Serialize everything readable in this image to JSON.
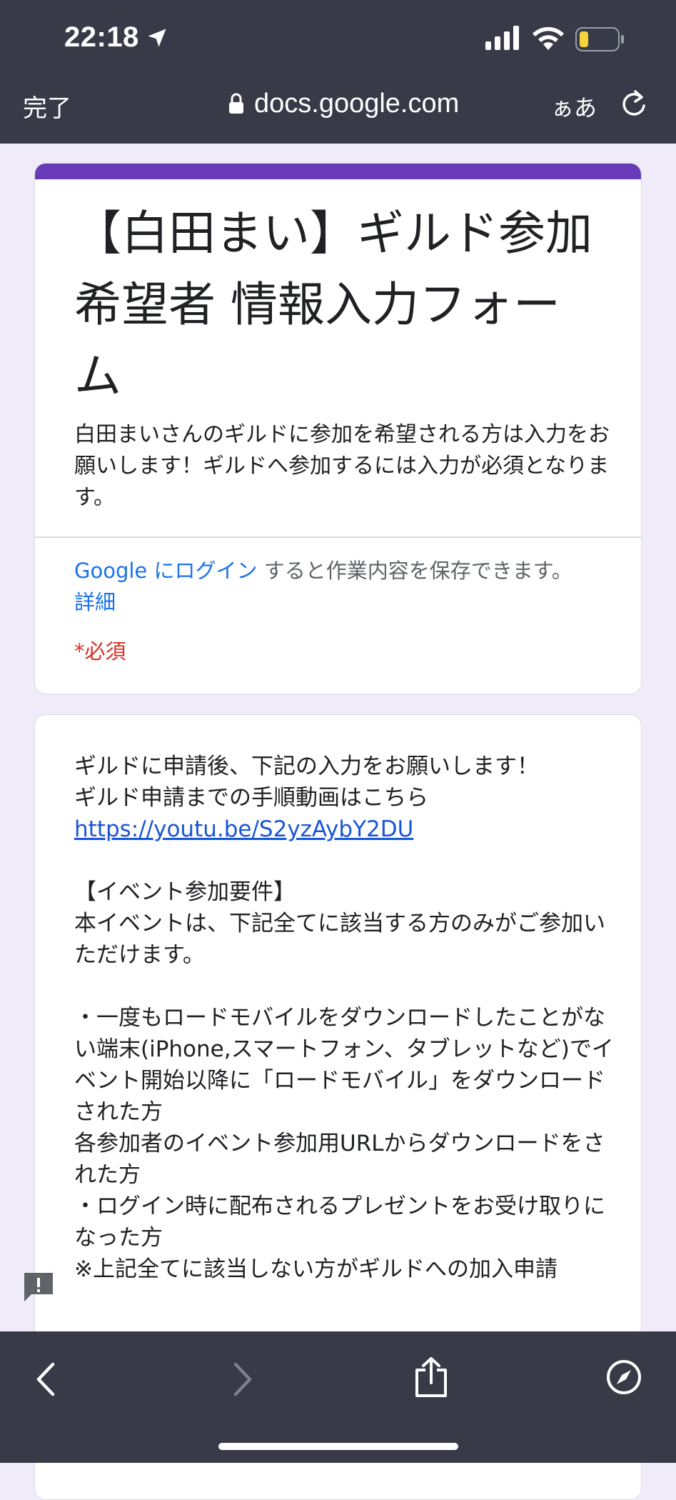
{
  "status_bar": {
    "time": "22:18",
    "icons": [
      "location-arrow-icon",
      "cellular-signal-icon",
      "wifi-icon",
      "battery-icon"
    ],
    "battery_color": "#f5d33a"
  },
  "browser": {
    "done_label": "完了",
    "url": "docs.google.com",
    "text_size_label": "ぁあ",
    "icons": [
      "lock-icon",
      "reload-icon"
    ]
  },
  "form": {
    "accent_color": "#673ab7",
    "title": "【白田まい】ギルド参加希望者 情報入力フォーム",
    "description": "白田まいさんのギルドに参加を希望される方は入力をお願いします！ギルドへ参加するには入力が必須となります。",
    "login_link": "Google にログイン",
    "login_rest": "すると作業内容を保存できます。",
    "details_link": "詳細",
    "required_label": "*必須"
  },
  "section": {
    "line1": "ギルドに申請後、下記の入力をお願いします！",
    "line2": "ギルド申請までの手順動画はこちら",
    "video_url": "https://youtu.be/S2yzAybY2DU",
    "requirements_heading": "【イベント参加要件】",
    "requirements_intro": "本イベントは、下記全てに該当する方のみがご参加いただけます。",
    "req1": "・一度もロードモバイルをダウンロードしたことがない端末(iPhone,スマートフォン、タブレットなど)でイベント開始以降に「ロードモバイル」をダウンロードされた方",
    "req2": "各参加者のイベント参加用URLからダウンロードをされた方",
    "req3": "・ログイン時に配布されるプレゼントをお受け取りになった方",
    "note": "※上記全てに該当しない方がギルドへの加入申請"
  },
  "toolbar": {
    "icons": [
      "back-icon",
      "forward-icon",
      "share-icon",
      "compass-icon",
      "feedback-icon"
    ]
  }
}
